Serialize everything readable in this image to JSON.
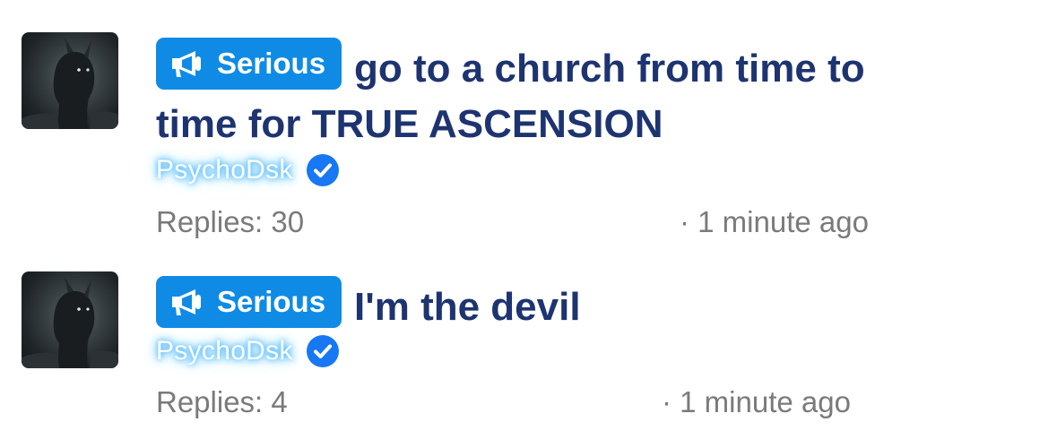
{
  "threads": [
    {
      "prefix": "Serious",
      "title": "go to a church from time to time for TRUE ASCENSION",
      "title_line1": "go to a church from time to",
      "title_line2": "time for TRUE ASCENSION",
      "author": "PsychoDsk",
      "replies": "Replies: 30",
      "time": "· 1 minute ago"
    },
    {
      "prefix": "Serious",
      "title": "I'm the devil",
      "author": "PsychoDsk",
      "replies": "Replies: 4",
      "time": "· 1 minute ago"
    }
  ],
  "colors": {
    "prefix_bg": "#0f8be6",
    "title": "#1e3470",
    "meta": "#7a7a7a",
    "verified": "#1877f2",
    "author_glow": "#43b4ff"
  },
  "icons": {
    "prefix": "megaphone-icon",
    "verified": "verified-check-icon"
  }
}
